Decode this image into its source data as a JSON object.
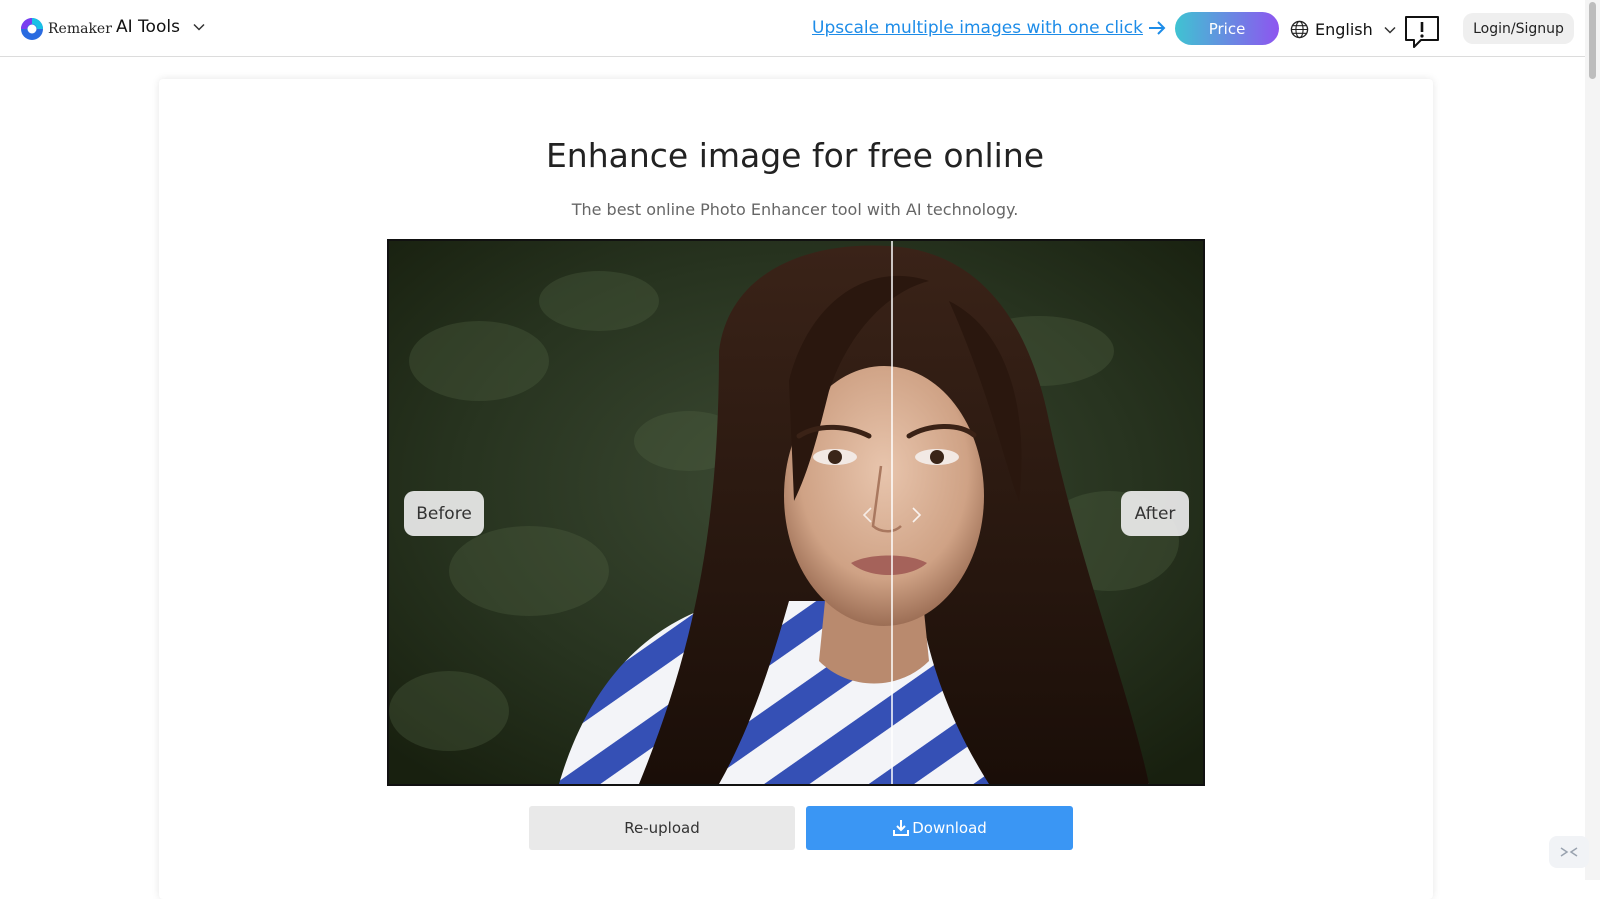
{
  "header": {
    "brand": "Remaker",
    "tools_label": "AI Tools",
    "upscale_link": "Upscale multiple images with one click",
    "price_label": "Price",
    "language": "English",
    "login_label": "Login/Signup"
  },
  "main": {
    "title": "Enhance image for free online",
    "subtitle": "The best online Photo Enhancer tool with AI technology.",
    "compare": {
      "before_label": "Before",
      "after_label": "After"
    },
    "reupload_label": "Re-upload",
    "download_label": "Download"
  },
  "colors": {
    "link": "#1d8ce8",
    "price_gradient_start": "#3fc3d2",
    "price_gradient_end": "#8e55f0",
    "download": "#3a96f4"
  },
  "icons": {
    "logo": "remaker-logo-icon",
    "tools_toggle": "chevron-down-icon",
    "upscale_arrow": "arrow-right-icon",
    "language": "globe-icon",
    "feedback": "feedback-icon",
    "compare_handle": "chevron-left-right-icon",
    "download": "download-icon"
  }
}
